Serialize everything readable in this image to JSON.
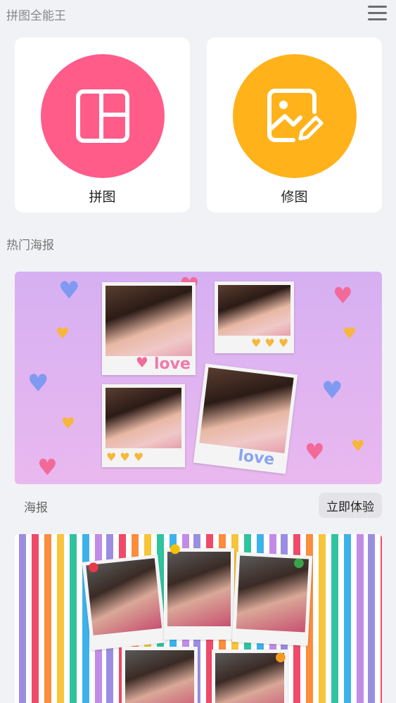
{
  "app": {
    "title": "拼图全能王"
  },
  "header": {
    "menu_icon": "hamburger-menu-icon"
  },
  "tools": [
    {
      "label": "拼图",
      "color": "#ff5c8a",
      "icon": "collage-icon"
    },
    {
      "label": "修图",
      "color": "#ffb21a",
      "icon": "photo-edit-icon"
    }
  ],
  "section": {
    "title": "热门海报"
  },
  "posters": [
    {
      "caption": "海报",
      "action": "立即体验",
      "text_1": "love",
      "text_2": "love"
    },
    {
      "caption": "",
      "action": ""
    }
  ]
}
